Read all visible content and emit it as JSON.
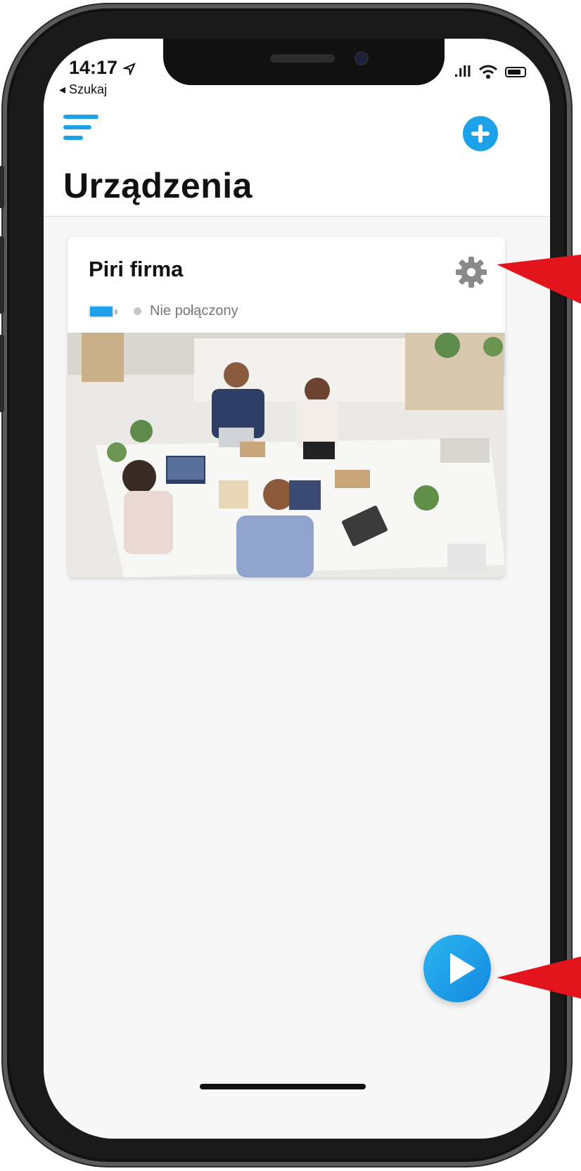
{
  "status_bar": {
    "time": "14:17",
    "back_label": "◂ Szukaj",
    "signal": ".ıll"
  },
  "header": {
    "title": "Urządzenia"
  },
  "device": {
    "name": "Piri firma",
    "connection_status": "Nie połączony"
  },
  "colors": {
    "accent": "#1da1e8",
    "annotation_arrow": "#e3141c"
  },
  "icons": [
    "menu-icon",
    "plus-icon",
    "gear-icon",
    "battery-icon",
    "wifi-icon",
    "play-icon"
  ]
}
